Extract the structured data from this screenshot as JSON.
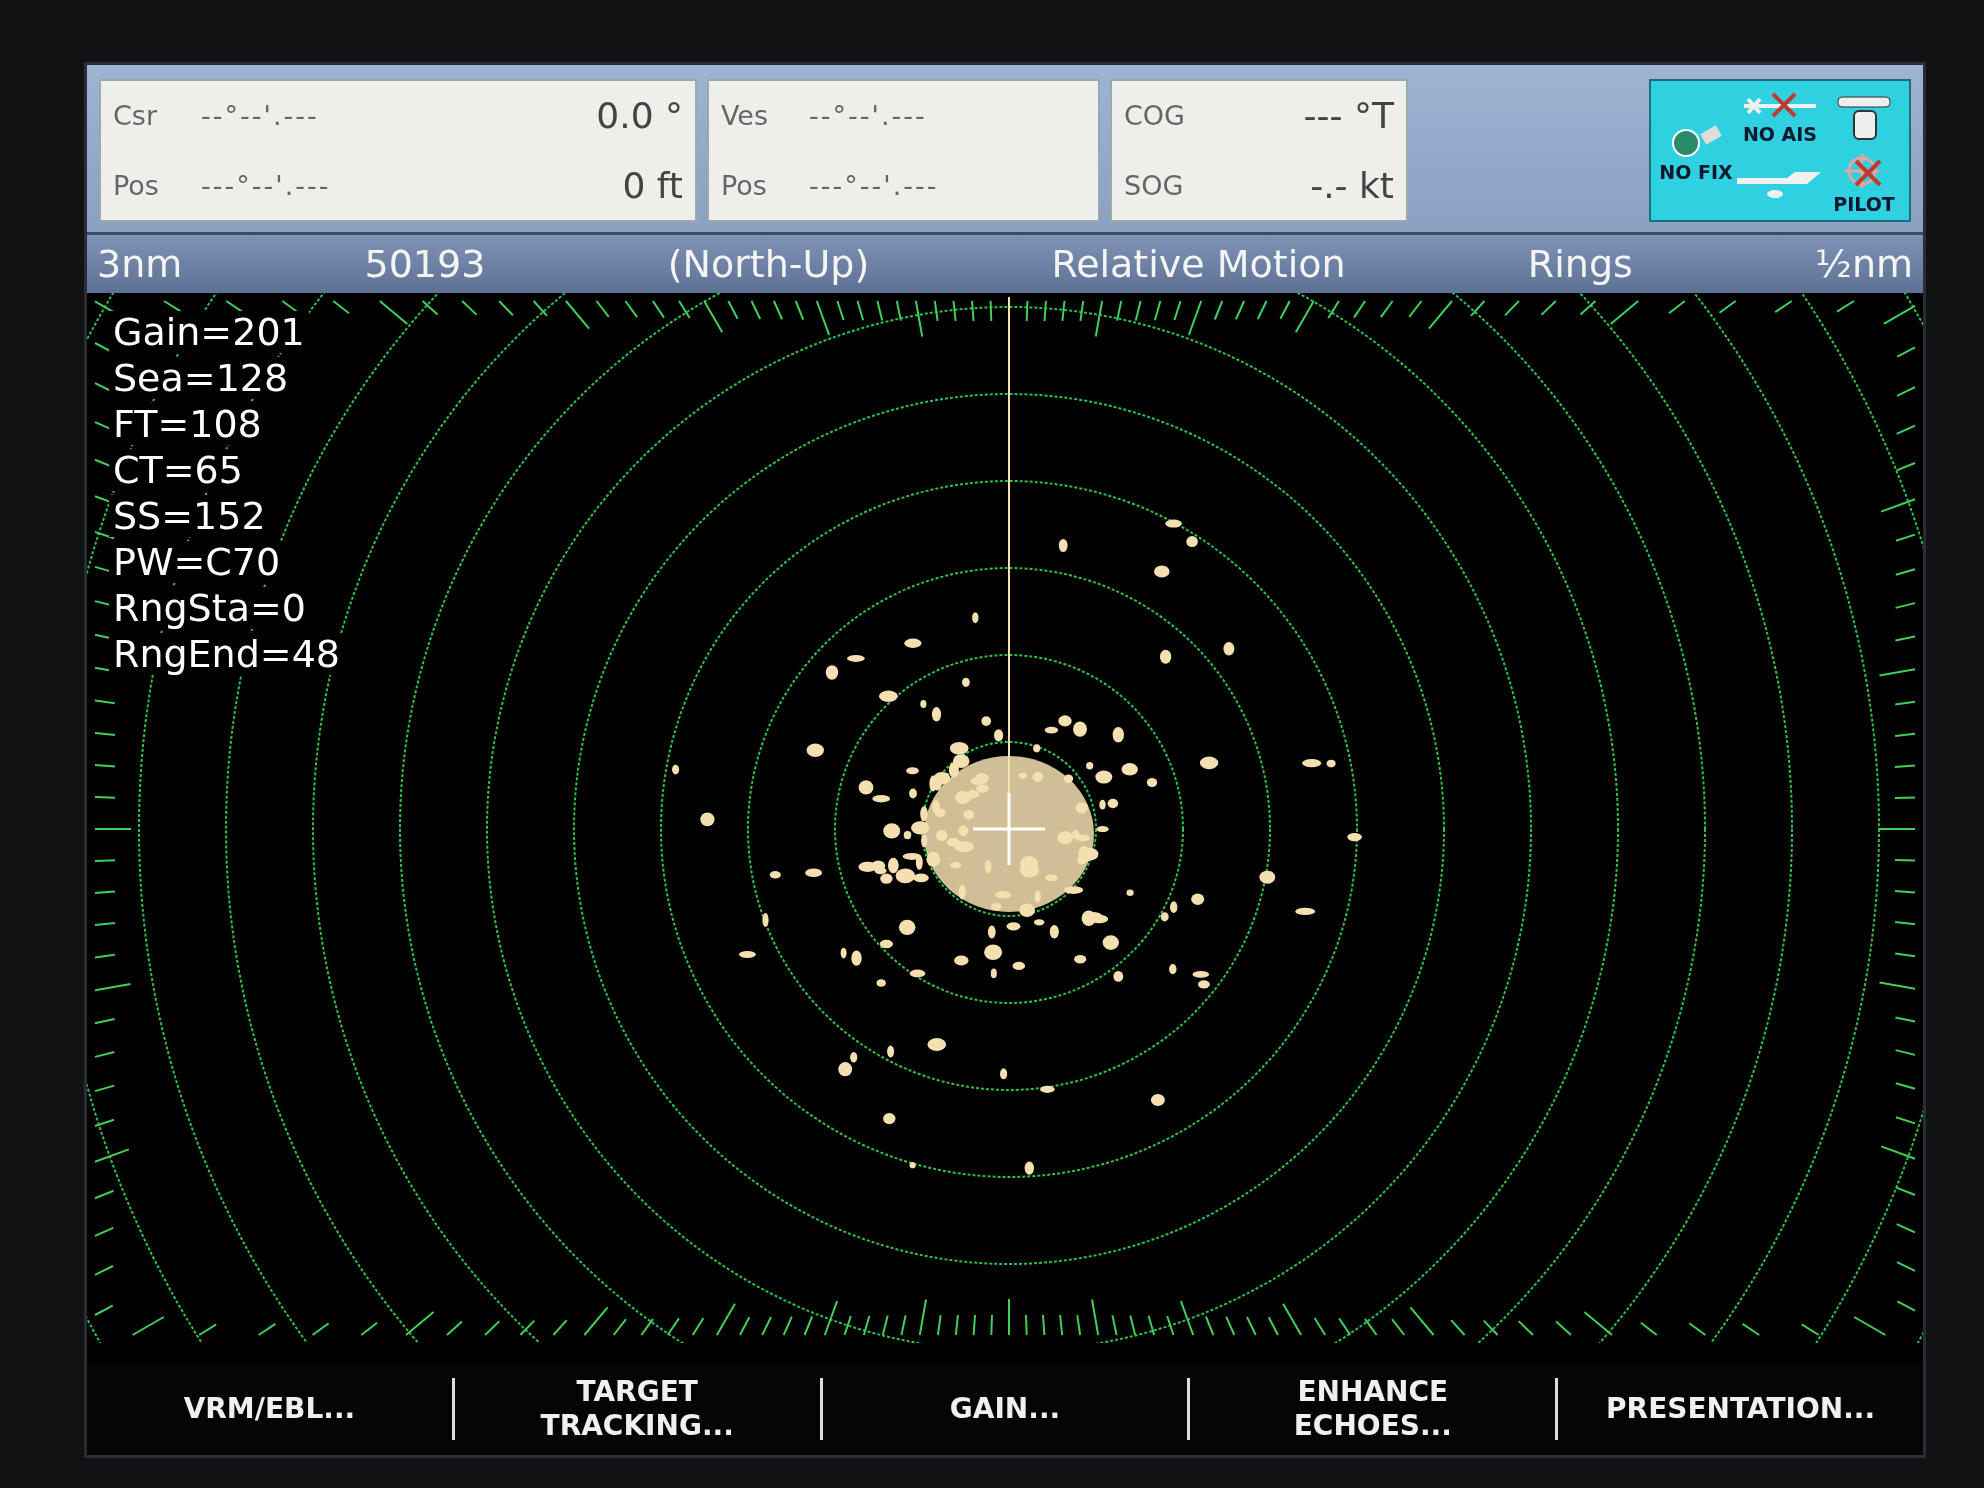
{
  "readouts": [
    {
      "rows": [
        {
          "label": "Csr",
          "position": "--°--'.---",
          "value": "0.0 °"
        },
        {
          "label": "Pos",
          "position": "---°--'.---",
          "value": "0 ft"
        }
      ]
    },
    {
      "rows": [
        {
          "label": "Ves",
          "position": "--°--'.---"
        },
        {
          "label": "Pos",
          "position": "---°--'.---"
        }
      ]
    },
    {
      "rows": [
        {
          "label": "COG",
          "value": "--- °T"
        },
        {
          "label": "SOG",
          "value": "-.- kt"
        }
      ]
    }
  ],
  "status_icons": {
    "fix": "NO FIX",
    "ais": "NO AIS",
    "pilot": "PILOT"
  },
  "status_bar": [
    "3nm",
    "50193",
    "(North-Up)",
    "Relative Motion",
    "Rings",
    "½nm"
  ],
  "settings": [
    "Gain=201",
    "Sea=128",
    "FT=108",
    "CT=65",
    "SS=152",
    "PW=C70",
    "RngSta=0",
    "RngEnd=48"
  ],
  "softkeys": [
    "VRM/EBL...",
    "TARGET\nTRACKING...",
    "GAIN...",
    "ENHANCE\nECHOES...",
    "PRESENTATION..."
  ]
}
